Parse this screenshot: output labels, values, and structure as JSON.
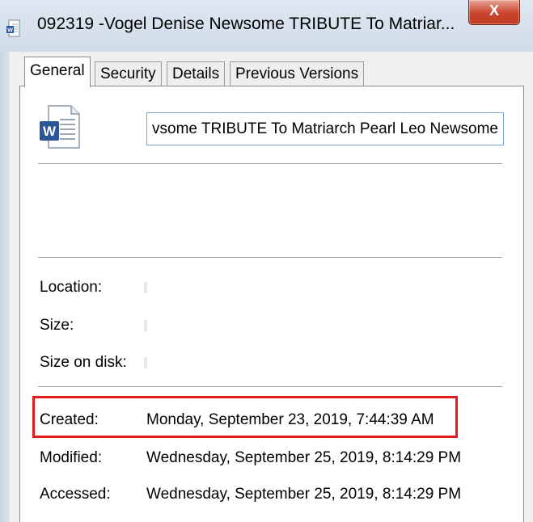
{
  "window": {
    "title": "092319 -Vogel Denise Newsome TRIBUTE To Matriar...",
    "close_symbol": "X",
    "title_icon": "word-document-icon"
  },
  "tabs": [
    {
      "label": "General",
      "active": true
    },
    {
      "label": "Security",
      "active": false
    },
    {
      "label": "Details",
      "active": false
    },
    {
      "label": "Previous Versions",
      "active": false
    }
  ],
  "general": {
    "file_icon": "word-document-icon",
    "file_name_value": "vsome TRIBUTE To Matriarch Pearl Leo Newsome",
    "location_label": "Location:",
    "size_label": "Size:",
    "size_on_disk_label": "Size on disk:",
    "created_label": "Created:",
    "created_value": "Monday, September 23, 2019, 7:44:39 AM",
    "modified_label": "Modified:",
    "modified_value": "Wednesday, September 25, 2019, 8:14:29 PM",
    "accessed_label": "Accessed:",
    "accessed_value": "Wednesday, September 25, 2019, 8:14:29 PM"
  },
  "colors": {
    "highlight_box": "#e01b1b",
    "close_button": "#c9452d",
    "word_blue": "#2b5797"
  }
}
